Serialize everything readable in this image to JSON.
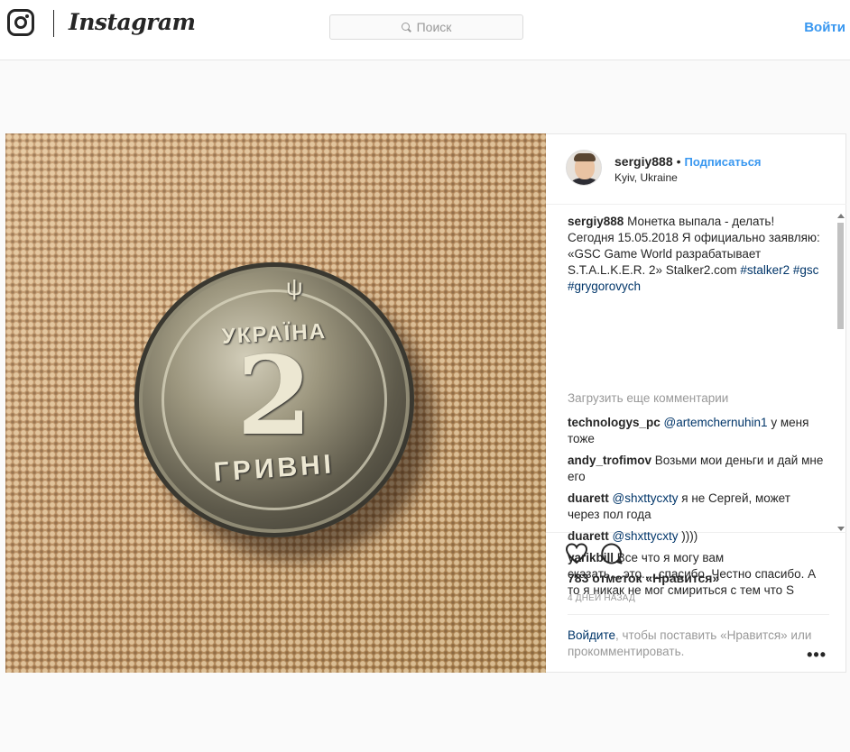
{
  "nav": {
    "brand": "Instagram",
    "search_placeholder": "Поиск",
    "login_label": "Войти"
  },
  "photo": {
    "coin_country": "УКРАЇНА",
    "coin_value": "2",
    "coin_currency": "ГРИВНІ",
    "coin_trident": "ψ"
  },
  "post": {
    "username": "sergiy888",
    "bullet": "•",
    "follow_label": "Подписаться",
    "location": "Kyiv, Ukraine",
    "caption": {
      "author": "sergiy888",
      "text": "Монетка выпала - делать! Сегодня 15.05.2018 Я официально заявляю: «GSC Game World разрабатывает S.T.A.L.K.E.R. 2» Stalker2.com",
      "tag1": "#stalker2",
      "tag2": "#gsc",
      "tag3": "#grygorovych"
    },
    "load_more": "Загрузить еще комментарии",
    "comments": [
      {
        "author": "technologys_pc",
        "mention": "@artemchernuhin1",
        "text": "у меня тоже"
      },
      {
        "author": "andy_trofimov",
        "mention": "",
        "text": "Возьми мои деньги и дай мне его"
      },
      {
        "author": "duarett",
        "mention": "@shxttycxty",
        "text": "я не Сергей, может через пол года"
      },
      {
        "author": "duarett",
        "mention": "@shxttycxty",
        "text": "))))"
      },
      {
        "author": "yarikbill",
        "mention": "",
        "text": "Все что я могу вам сказать....это.....спасибо. Честно спасибо. А то я никак не мог смириться с тем что S"
      }
    ],
    "likes": "783 отметок «Нравится»",
    "time_ago": "4 ДНЕЙ НАЗАД",
    "login_prompt_link": "Войдите",
    "login_prompt_text": ", чтобы поставить «Нравится» или прокомментировать.",
    "more_label": "•••",
    "icons": {
      "like": "heart-icon",
      "comment": "comment-icon",
      "search": "search-icon",
      "brand": "instagram-glyph-icon"
    }
  }
}
